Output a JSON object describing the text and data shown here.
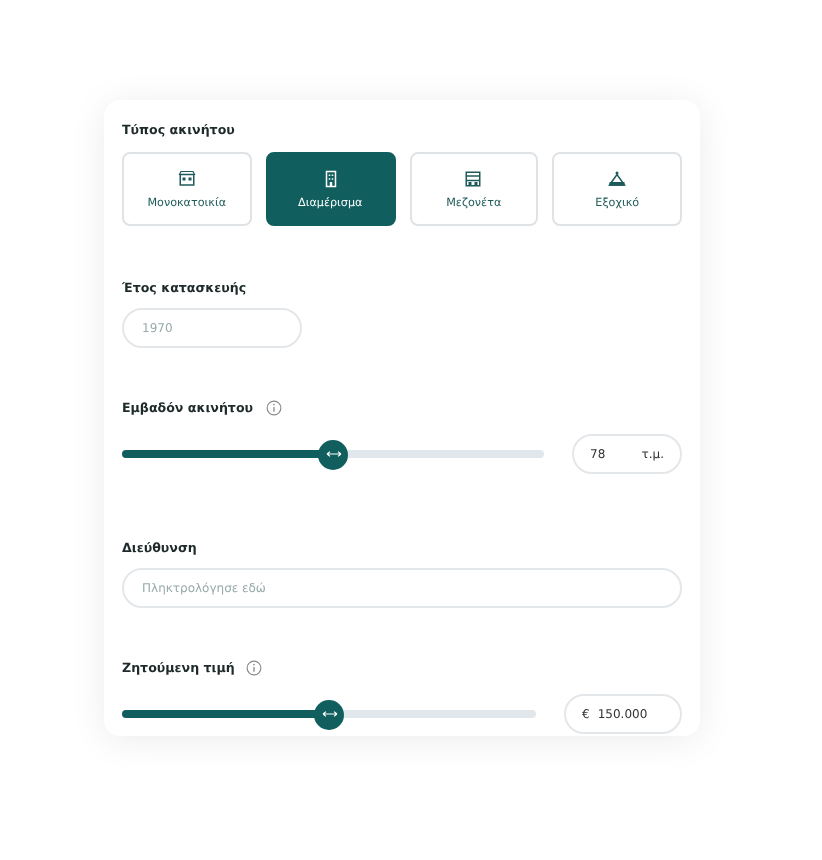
{
  "property_type": {
    "label": "Τύπος ακινήτου",
    "options": [
      {
        "kind": "house",
        "label": "Μονοκατοικία",
        "selected": false
      },
      {
        "kind": "apartment",
        "label": "Διαμέρισμα",
        "selected": true
      },
      {
        "kind": "maisonette",
        "label": "Μεζονέτα",
        "selected": false
      },
      {
        "kind": "cottage",
        "label": "Εξοχικό",
        "selected": false
      }
    ]
  },
  "year": {
    "label": "Έτος κατασκευής",
    "placeholder": "1970"
  },
  "area": {
    "label": "Εμβαδόν ακινήτου",
    "level": 0.5,
    "value": "78",
    "unit": "τ.μ."
  },
  "address": {
    "label": "Διεύθυνση",
    "placeholder": "Πληκτρολόγησε εδώ"
  },
  "price": {
    "label": "Ζητούμενη τιμή",
    "level": 0.5,
    "currency": "€",
    "value": "150.000"
  }
}
